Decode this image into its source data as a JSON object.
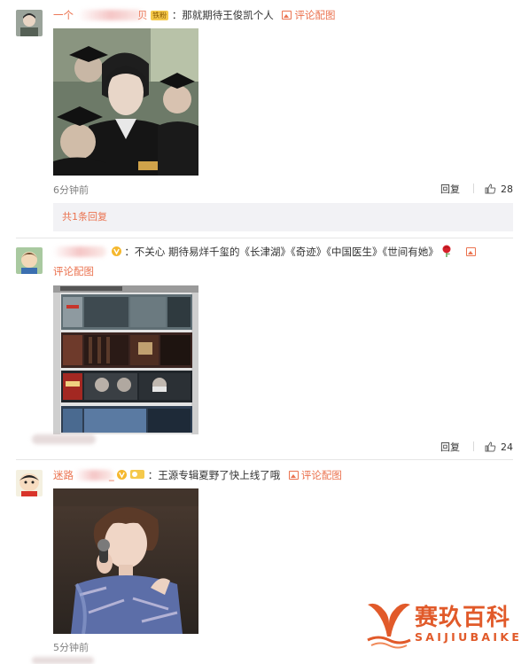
{
  "accent_color": "#eb7350",
  "comments": [
    {
      "username_visible": "一个",
      "username_tail": "贝",
      "badge": "铁粉",
      "text": "：那就期待王俊凯个人",
      "pic_link": "评论配图",
      "avatar_icon": "user-avatar-photo",
      "image_desc": "graduation-photo",
      "time": "6分钟前",
      "reply_label": "回复",
      "like_count": "28",
      "reply_summary": "共1条回复"
    },
    {
      "text": "：不关心 期待易烊千玺的《长津湖》《奇迹》《中国医生》《世间有她》",
      "emoji": "rose-emoji",
      "pic_link": "评论配图",
      "avatar_icon": "user-avatar-cartoon",
      "image_desc": "movie-poster-collage",
      "reply_label": "回复",
      "like_count": "24"
    },
    {
      "username_visible": "迷路",
      "username_tail": "_",
      "text": "：王源专辑夏野了快上线了哦",
      "pic_link": "评论配图",
      "avatar_icon": "user-avatar-crayon-shin",
      "image_desc": "singer-on-stage",
      "time": "5分钟前"
    }
  ],
  "watermark": {
    "title": "赛玖百科",
    "subtitle": "SAIJIUBAIKE",
    "logo_icon": "whale-tail-icon"
  }
}
